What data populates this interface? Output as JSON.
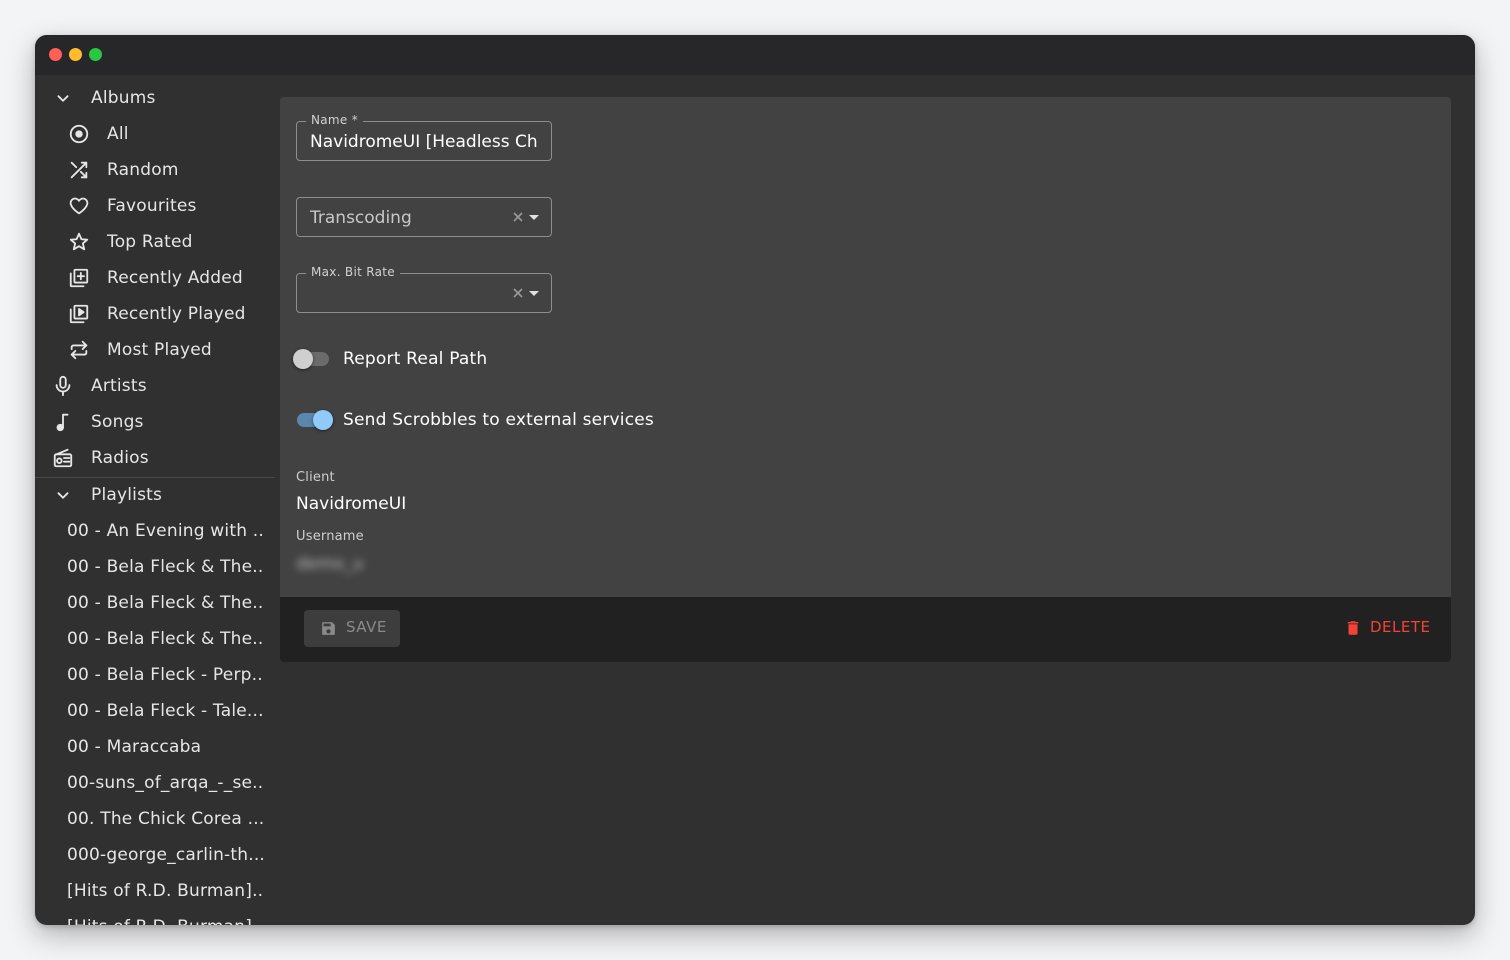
{
  "window": {
    "controls": [
      "close",
      "minimize",
      "maximize"
    ]
  },
  "sidebar": {
    "albums": {
      "label": "Albums",
      "items": [
        {
          "label": "All",
          "icon": "album-icon"
        },
        {
          "label": "Random",
          "icon": "shuffle-icon"
        },
        {
          "label": "Favourites",
          "icon": "heart-icon"
        },
        {
          "label": "Top Rated",
          "icon": "star-icon"
        },
        {
          "label": "Recently Added",
          "icon": "library-add-icon"
        },
        {
          "label": "Recently Played",
          "icon": "library-play-icon"
        },
        {
          "label": "Most Played",
          "icon": "repeat-icon"
        }
      ]
    },
    "artists": "Artists",
    "songs": "Songs",
    "radios": "Radios",
    "playlists": {
      "label": "Playlists",
      "items": [
        "00 - An Evening with ...",
        "00 - Bela Fleck & The...",
        "00 - Bela Fleck & The...",
        "00 - Bela Fleck & The...",
        "00 - Bela Fleck - Perp...",
        "00 - Bela Fleck - Tale...",
        "00 - Maraccaba",
        "00-suns_of_arqa_-_se...",
        "00. The Chick Corea ...",
        "000-george_carlin-th...",
        "[Hits of R.D. Burman]...",
        "[Hits of R.D. Burman]..."
      ]
    }
  },
  "form": {
    "name": {
      "label": "Name *",
      "value": "NavidromeUI [Headless Chrome]"
    },
    "transcoding": {
      "placeholder": "Transcoding",
      "value": ""
    },
    "max_bit_rate": {
      "label": "Max. Bit Rate",
      "value": ""
    },
    "report_real_path": {
      "label": "Report Real Path",
      "checked": false
    },
    "send_scrobbles": {
      "label": "Send Scrobbles to external services",
      "checked": true
    },
    "client": {
      "label": "Client",
      "value": "NavidromeUI"
    },
    "username": {
      "label": "Username",
      "value": "demo_u"
    }
  },
  "toolbar": {
    "save_label": "SAVE",
    "delete_label": "DELETE"
  },
  "colors": {
    "accent": "#90caf9",
    "danger": "#f44336",
    "panel": "#424242",
    "background": "#303030"
  }
}
